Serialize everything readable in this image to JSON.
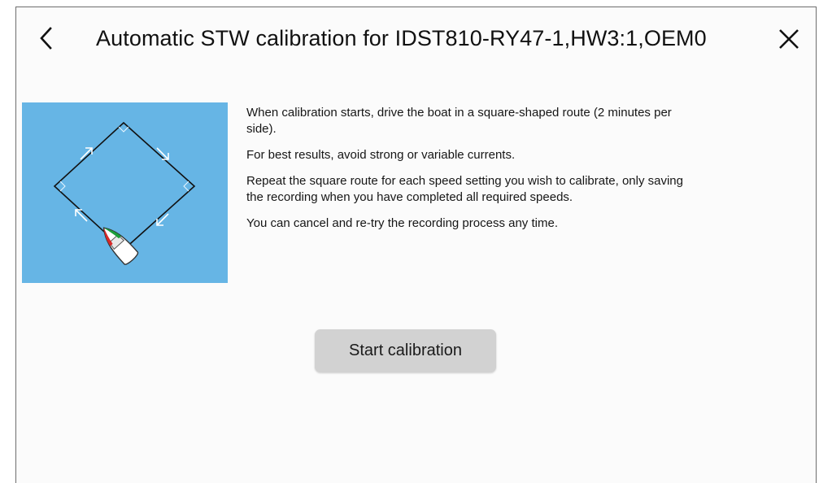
{
  "header": {
    "title": "Automatic STW calibration for IDST810-RY47-1,HW3:1,OEM0",
    "back_icon": "chevron-left-icon",
    "close_icon": "close-icon"
  },
  "instructions": {
    "paragraphs": [
      "When calibration starts, drive the boat in a square-shaped route (2 minutes per side).",
      "For best results, avoid strong or variable currents.",
      "Repeat the square route for each speed setting you wish to calibrate, only saving the recording when you have completed all required speeds.",
      "You can cancel and re-try the recording process any time."
    ]
  },
  "actions": {
    "start_label": "Start calibration"
  },
  "colors": {
    "illustration_background": "#66b5e5",
    "button_background": "#d2d2d2"
  }
}
